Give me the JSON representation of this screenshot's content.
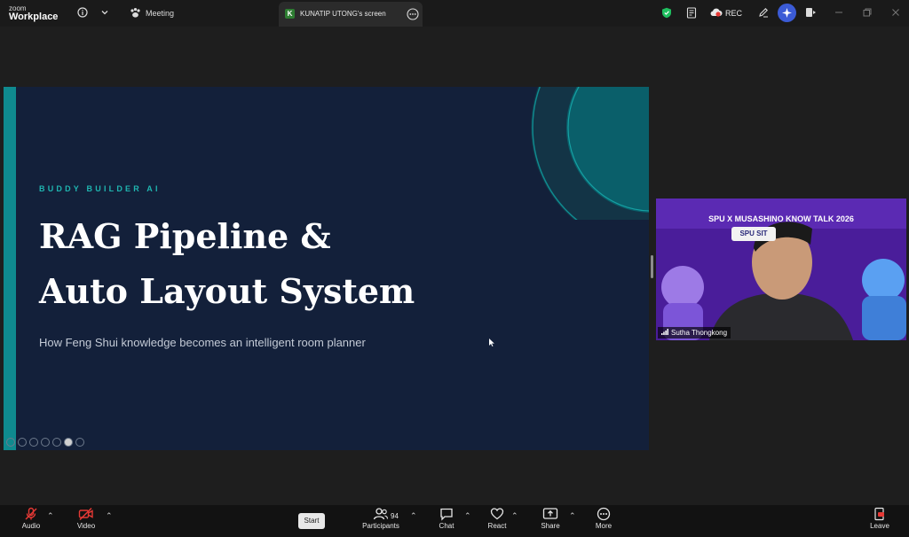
{
  "app": {
    "brand_small": "zoom",
    "brand_big": "Workplace"
  },
  "topbar": {
    "meeting_label": "Meeting",
    "share_tab": {
      "initial": "K",
      "title": "KUNATIP UTONG's screen"
    },
    "rec_label": "REC",
    "icons": [
      "info-icon",
      "chevron-down-icon",
      "meeting-paw-icon",
      "more-options-icon",
      "security-shield-icon",
      "notes-icon",
      "cloud-record-icon",
      "edit-icon",
      "ai-companion-icon",
      "apps-icon",
      "minimize-icon",
      "restore-icon",
      "close-icon"
    ]
  },
  "slide": {
    "eyebrow": "BUDDY BUILDER AI",
    "title_line1": "RAG Pipeline &",
    "title_line2": "Auto Layout System",
    "subtitle": "How Feng Shui knowledge becomes an intelligent room planner",
    "colors": {
      "background": "#13203a",
      "accent": "#0f8a8f",
      "eyebrow": "#1fb5b0"
    }
  },
  "video": {
    "banner_text": "SPU X MUSASHINO KNOW      TALK 2026",
    "logo_text": "SPU SIT",
    "participant_name": "Sutha Thongkong"
  },
  "toolbar": {
    "audio": "Audio",
    "video": "Video",
    "start": "Start",
    "participants": "Participants",
    "participant_count": "94",
    "chat": "Chat",
    "react": "React",
    "share": "Share",
    "more": "More",
    "leave": "Leave"
  }
}
